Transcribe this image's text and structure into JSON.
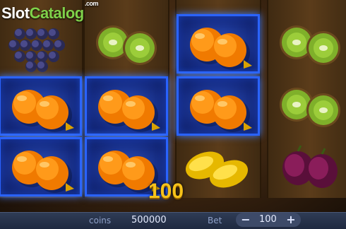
{
  "logo": {
    "prefix": "Slot",
    "suffix": "Catalog",
    "tld": ".com"
  },
  "reels": [
    [
      "grapes",
      "orange",
      "orange"
    ],
    [
      "kiwi",
      "orange",
      "orange"
    ],
    [
      "orange",
      "orange",
      "lemon"
    ],
    [
      "kiwi",
      "kiwi",
      "plum"
    ]
  ],
  "winning_cells": [
    [
      0,
      1
    ],
    [
      0,
      2
    ],
    [
      1,
      1
    ],
    [
      1,
      2
    ],
    [
      2,
      0
    ],
    [
      2,
      1
    ]
  ],
  "win_amount": "100",
  "bottom_bar": {
    "coins_label": "coins",
    "coins_value": "500000",
    "bet_label": "Bet",
    "bet_value": "100",
    "minus_label": "−",
    "plus_label": "+"
  },
  "colors": {
    "win_border": "#2a63ff",
    "win_text": "#f6c21a",
    "bar_bg": "#2f3c55"
  }
}
